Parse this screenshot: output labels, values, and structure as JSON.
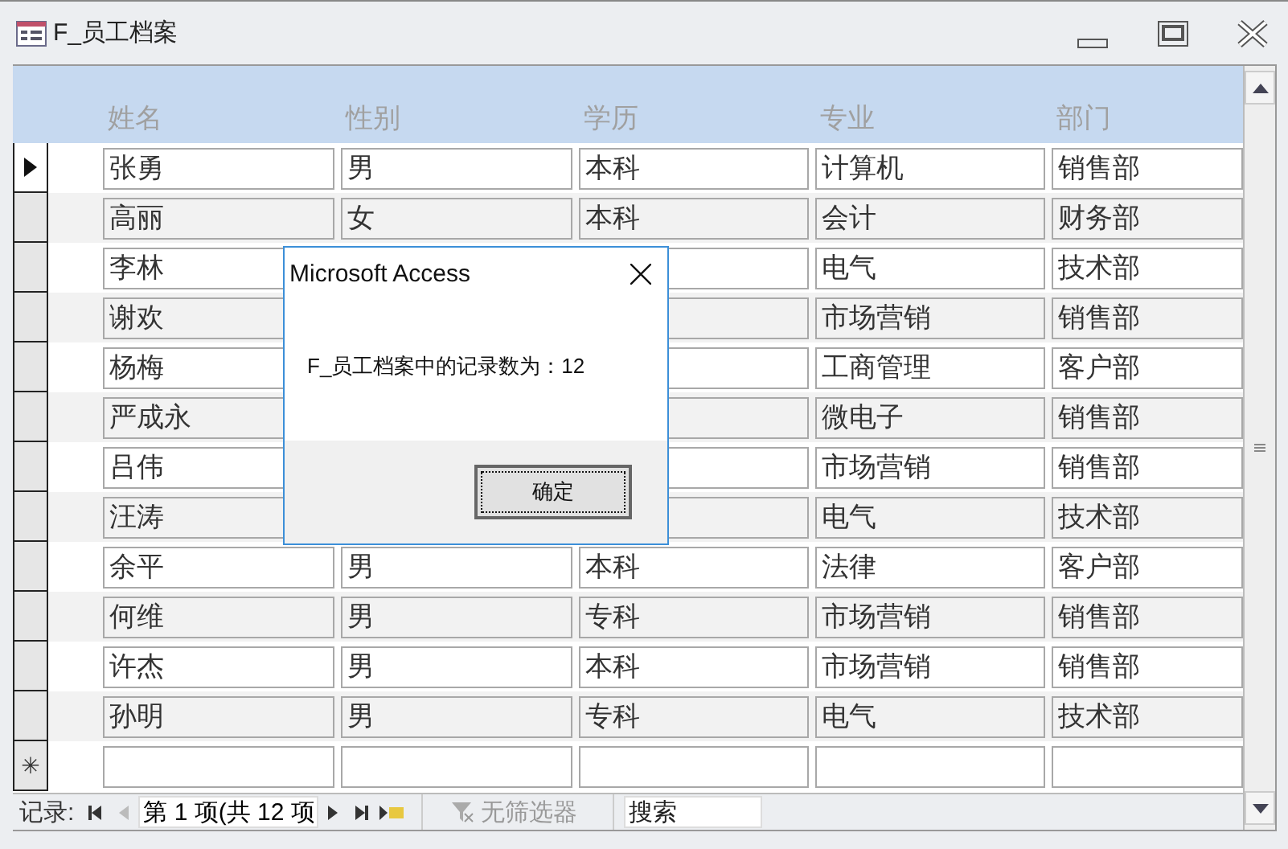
{
  "window": {
    "title": "F_员工档案"
  },
  "columns": [
    "姓名",
    "性别",
    "学历",
    "专业",
    "部门"
  ],
  "rows": [
    {
      "current": true,
      "name": "张勇",
      "gender": "男",
      "education": "本科",
      "major": "计算机",
      "dept": "销售部"
    },
    {
      "current": false,
      "name": "高丽",
      "gender": "女",
      "education": "本科",
      "major": "会计",
      "dept": "财务部"
    },
    {
      "current": false,
      "name": "李林",
      "major": "电气",
      "dept": "技术部"
    },
    {
      "current": false,
      "name": "谢欢",
      "major": "市场营销",
      "dept": "销售部"
    },
    {
      "current": false,
      "name": "杨梅",
      "major": "工商管理",
      "dept": "客户部"
    },
    {
      "current": false,
      "name": "严成永",
      "major": "微电子",
      "dept": "销售部"
    },
    {
      "current": false,
      "name": "吕伟",
      "major": "市场营销",
      "dept": "销售部"
    },
    {
      "current": false,
      "name": "汪涛",
      "major": "电气",
      "dept": "技术部"
    },
    {
      "current": false,
      "name": "余平",
      "gender": "男",
      "education": "本科",
      "major": "法律",
      "dept": "客户部"
    },
    {
      "current": false,
      "name": "何维",
      "gender": "男",
      "education": "专科",
      "major": "市场营销",
      "dept": "销售部"
    },
    {
      "current": false,
      "name": "许杰",
      "gender": "男",
      "education": "本科",
      "major": "市场营销",
      "dept": "销售部"
    },
    {
      "current": false,
      "name": "孙明",
      "gender": "男",
      "education": "专科",
      "major": "电气",
      "dept": "技术部"
    }
  ],
  "new_row_marker": "✳",
  "navigation": {
    "label": "记录:",
    "position": "第 1 项(共 12 项",
    "filter": "无筛选器",
    "search_placeholder": "搜索"
  },
  "dialog": {
    "title": "Microsoft Access",
    "message": "F_员工档案中的记录数为：12",
    "button": "确定"
  }
}
